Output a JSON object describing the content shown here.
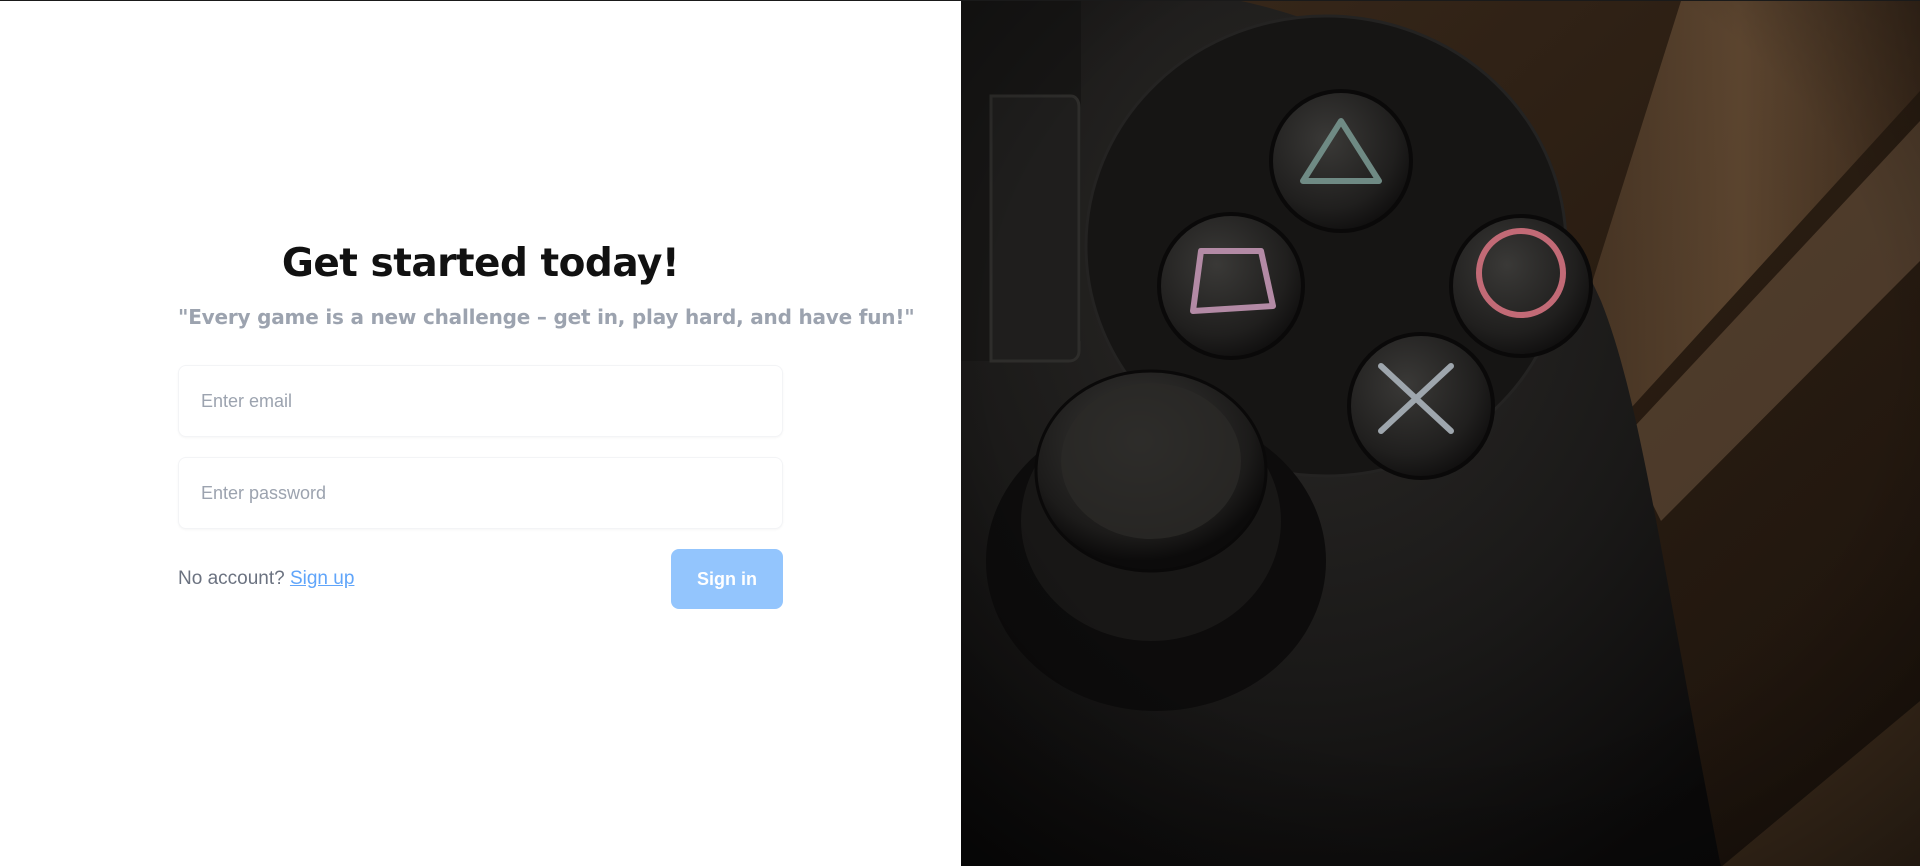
{
  "login": {
    "heading": "Get started today!",
    "tagline": "\"Every game is a new challenge – get in, play hard, and have fun!\"",
    "email": {
      "placeholder": "Enter email",
      "value": ""
    },
    "password": {
      "placeholder": "Enter password",
      "value": ""
    },
    "no_account_text": "No account? ",
    "signup_link": "Sign up",
    "signin_button": "Sign in"
  },
  "hero_image": {
    "subject": "game controller",
    "icons": [
      "triangle-button-icon",
      "square-button-icon",
      "circle-button-icon",
      "cross-button-icon"
    ]
  },
  "colors": {
    "accent_button": "#93c5fd",
    "link": "#60a5fa",
    "muted_text": "#9ca3af"
  }
}
